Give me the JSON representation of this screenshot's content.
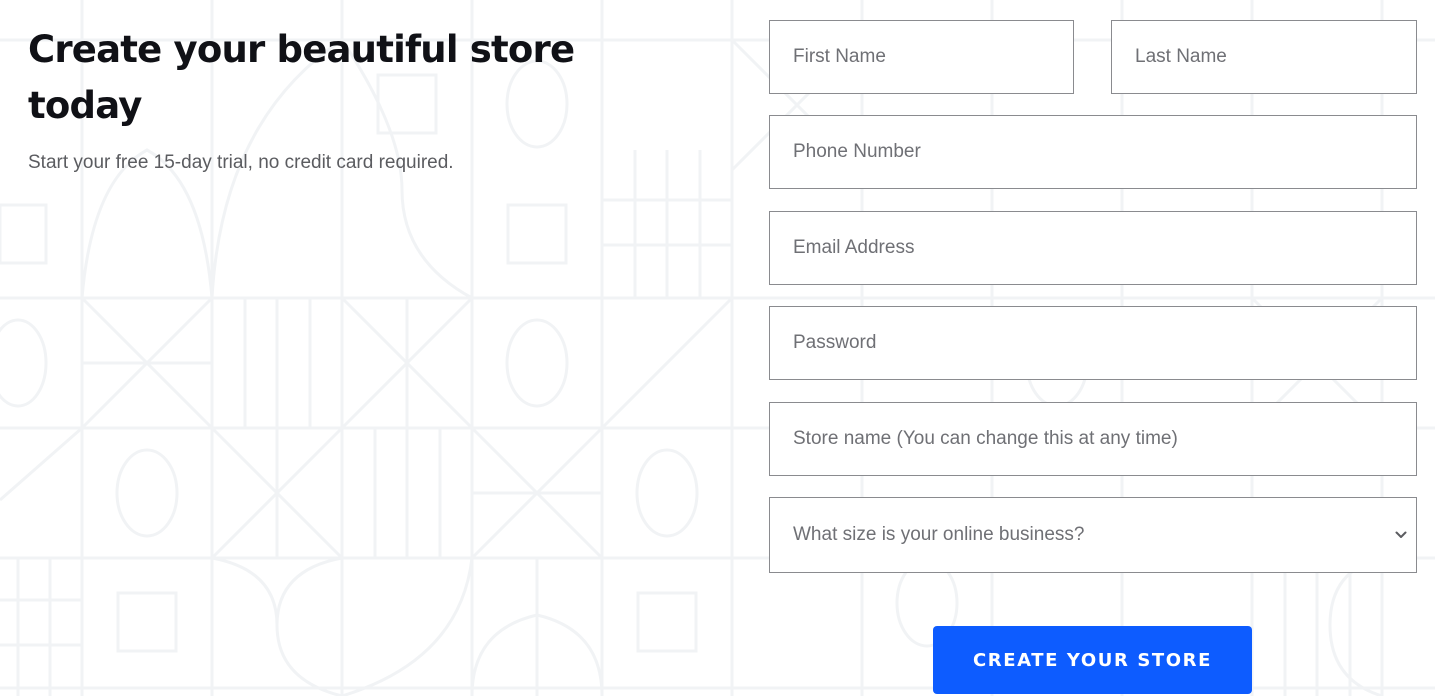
{
  "hero": {
    "title": "Create your beautiful store today",
    "subtitle": "Start your free 15-day trial, no credit card required."
  },
  "form": {
    "first_name": {
      "placeholder": "First Name",
      "value": ""
    },
    "last_name": {
      "placeholder": "Last Name",
      "value": ""
    },
    "phone": {
      "placeholder": "Phone Number",
      "value": ""
    },
    "email": {
      "placeholder": "Email Address",
      "value": ""
    },
    "password": {
      "placeholder": "Password",
      "value": ""
    },
    "store_name": {
      "placeholder": "Store name (You can change this at any time)",
      "value": ""
    },
    "business_size": {
      "selected": "What size is your online business?",
      "icon": "chevron-down-icon"
    },
    "submit_label": "CREATE YOUR STORE"
  },
  "colors": {
    "primary": "#0d5cff",
    "heading": "#101116",
    "body_text": "#5b5c60",
    "field_border": "#8a8b8f",
    "placeholder": "#6f7075",
    "pattern_line": "#f1f3f5"
  }
}
